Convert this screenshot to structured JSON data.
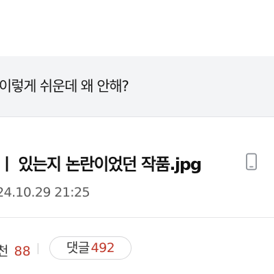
{
  "related": {
    "title": "이렇게 쉬운데 왜 안해?"
  },
  "post": {
    "title": "ㅣ 있는지 논란이었던 작품.jpg",
    "device_icon": "mobile-phone-icon",
    "datetime": "24.10.29 21:25"
  },
  "stats": {
    "like_label": "천",
    "like_count": "88",
    "comment_label": "댓글",
    "comment_count": "492"
  },
  "colors": {
    "accent_count": "#c0392b",
    "related_bg": "#f3f4f6"
  }
}
